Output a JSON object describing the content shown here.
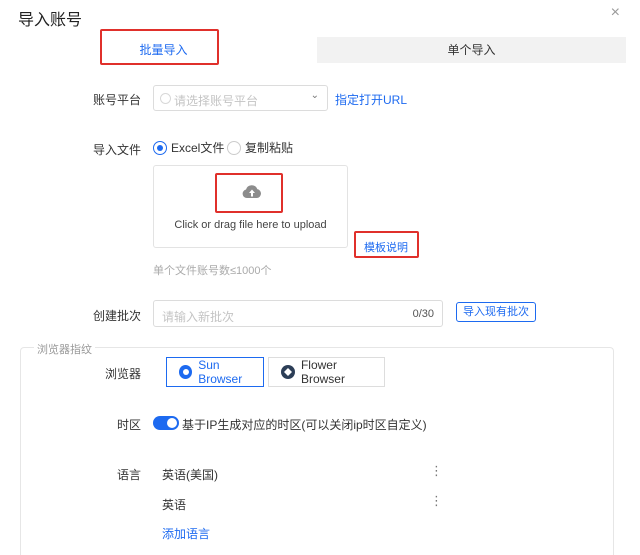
{
  "dialog": {
    "title": "导入账号",
    "close_glyph": "×"
  },
  "tabs": [
    {
      "label": "批量导入",
      "active": true
    },
    {
      "label": "单个导入",
      "active": false
    }
  ],
  "platform": {
    "label": "账号平台",
    "placeholder": "请选择账号平台",
    "link": "指定打开URL"
  },
  "import_file": {
    "label": "导入文件",
    "options": [
      {
        "label": "Excel文件",
        "selected": true
      },
      {
        "label": "复制粘贴",
        "selected": false
      }
    ],
    "upload_text": "Click or drag file here to upload",
    "template_link": "模板说明",
    "hint": "单个文件账号数≤1000个"
  },
  "batch": {
    "label": "创建批次",
    "placeholder": "请输入新批次",
    "counter": "0/30",
    "button": "导入现有批次"
  },
  "fingerprint": {
    "legend": "浏览器指纹",
    "browser_label": "浏览器",
    "browsers": [
      {
        "label": "Sun Browser",
        "selected": true,
        "icon": "sun-browser-icon"
      },
      {
        "label": "Flower Browser",
        "selected": false,
        "icon": "flower-browser-icon"
      }
    ],
    "timezone_label": "时区",
    "timezone_text": "基于IP生成对应的时区(可以关闭ip时区自定义)",
    "timezone_on": true,
    "language_label": "语言",
    "languages": [
      "英语(美国)",
      "英语"
    ],
    "add_language": "添加语言"
  },
  "colors": {
    "accent": "#1d6af0",
    "highlight_box": "#e0302b"
  }
}
